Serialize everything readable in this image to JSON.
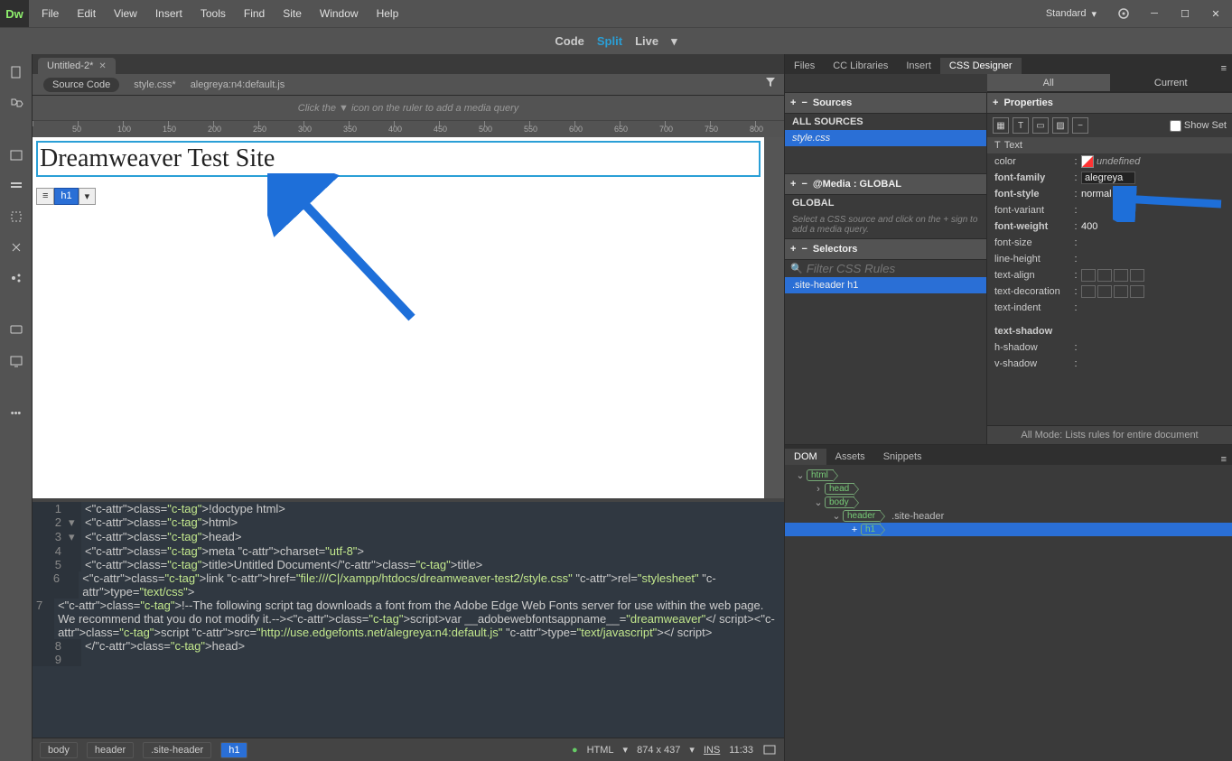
{
  "app": {
    "logo": "Dw"
  },
  "menu": [
    "File",
    "Edit",
    "View",
    "Insert",
    "Tools",
    "Find",
    "Site",
    "Window",
    "Help"
  ],
  "workspace": {
    "label": "Standard"
  },
  "viewmodes": {
    "code": "Code",
    "split": "Split",
    "live": "Live",
    "active": "Split"
  },
  "document": {
    "tab": "Untitled-2*",
    "subfiles": {
      "source": "Source Code",
      "css": "style.css*",
      "js": "alegreya:n4:default.js"
    }
  },
  "mediaHint": "Click the   ▼   icon on the ruler to add a media query",
  "liveview": {
    "h1": "Dreamweaver Test Site",
    "badge": "h1"
  },
  "code": {
    "lines": [
      {
        "n": 1,
        "f": "",
        "t": "<!doctype html>"
      },
      {
        "n": 2,
        "f": "▾",
        "t": "<html>"
      },
      {
        "n": 3,
        "f": "▾",
        "t": "<head>"
      },
      {
        "n": 4,
        "f": "",
        "t": "<meta charset=\"utf-8\">"
      },
      {
        "n": 5,
        "f": "",
        "t": "<title>Untitled Document</title>"
      },
      {
        "n": 6,
        "f": "",
        "t": "<link href=\"file:///C|/xampp/htdocs/dreamweaver-test2/style.css\" rel=\"stylesheet\" type=\"text/css\">"
      },
      {
        "n": 7,
        "f": "",
        "t": "<!--The following script tag downloads a font from the Adobe Edge Web Fonts server for use within the web page. We recommend that you do not modify it.--><script>var __adobewebfontsappname__=\"dreamweaver\"</ script><script src=\"http://use.edgefonts.net/alegreya:n4:default.js\" type=\"text/javascript\"></ script>"
      },
      {
        "n": 8,
        "f": "",
        "t": "</head>"
      },
      {
        "n": 9,
        "f": "",
        "t": ""
      }
    ]
  },
  "breadcrumb": [
    "body",
    "header",
    ".site-header",
    "h1"
  ],
  "status": {
    "lang": "HTML",
    "size": "874 x 437",
    "ins": "INS",
    "time": "11:33"
  },
  "rightPanels": {
    "tabs": [
      "Files",
      "CC Libraries",
      "Insert",
      "CSS Designer"
    ],
    "activeTab": "CSS Designer",
    "cssDesigner": {
      "subtabs": [
        "All",
        "Current"
      ],
      "activeSub": "All",
      "sourcesHdr": "Sources",
      "allSources": "ALL SOURCES",
      "sourceFile": "style.css",
      "mediaHdr": "@Media :  GLOBAL",
      "mediaGlobal": "GLOBAL",
      "mediaHelp": "Select a CSS source and click on the + sign to add a media query.",
      "selectorsHdr": "Selectors",
      "filterPlaceholder": "Filter CSS Rules",
      "selector": ".site-header h1",
      "propsHdr": "Properties",
      "showSet": "Show Set",
      "textSection": "Text",
      "props": {
        "color": {
          "label": "color",
          "value": "undefined"
        },
        "fontFamily": {
          "label": "font-family",
          "value": "alegreya"
        },
        "fontStyle": {
          "label": "font-style",
          "value": "normal"
        },
        "fontVariant": {
          "label": "font-variant",
          "value": ""
        },
        "fontWeight": {
          "label": "font-weight",
          "value": "400"
        },
        "fontSize": {
          "label": "font-size",
          "value": ""
        },
        "lineHeight": {
          "label": "line-height",
          "value": ""
        },
        "textAlign": {
          "label": "text-align",
          "value": ""
        },
        "textDecoration": {
          "label": "text-decoration",
          "value": ""
        },
        "textIndent": {
          "label": "text-indent",
          "value": ""
        },
        "textShadow": {
          "label": "text-shadow",
          "value": ""
        },
        "hShadow": {
          "label": "h-shadow",
          "value": ""
        },
        "vShadow": {
          "label": "v-shadow",
          "value": ""
        }
      },
      "allMode": "All Mode: Lists rules for entire document"
    },
    "domTabs": [
      "DOM",
      "Assets",
      "Snippets"
    ],
    "activeDom": "DOM",
    "dom": {
      "html": "html",
      "head": "head",
      "body": "body",
      "header": "header",
      "headerClass": ".site-header",
      "h1": "h1"
    }
  }
}
